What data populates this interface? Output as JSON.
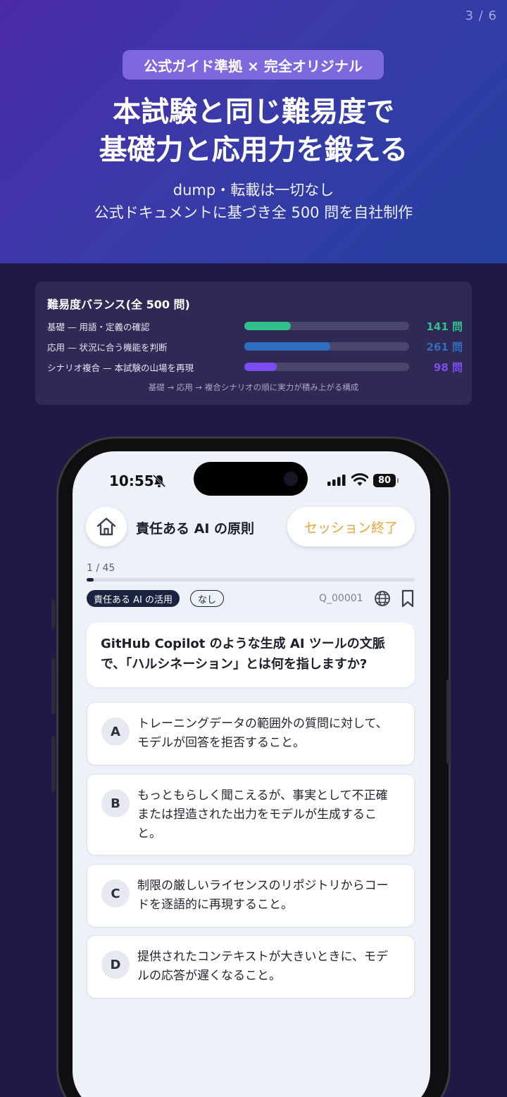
{
  "page_counter": "3 / 6",
  "hero": {
    "badge": "公式ガイド準拠 × 完全オリジナル",
    "headline_line1": "本試験と同じ難易度で",
    "headline_line2": "基礎力と応用力を鍛える",
    "sub_line1": "dump・転載は一切なし",
    "sub_line2": "公式ドキュメントに基づき全 500 問を自社制作"
  },
  "difficulty": {
    "title": "難易度バランス(全 500 問)",
    "rows": [
      {
        "label": "基礎 — 用語・定義の確認",
        "count": "141 問",
        "value": 141,
        "color": "#2fc08c"
      },
      {
        "label": "応用 — 状況に合う機能を判断",
        "count": "261 問",
        "value": 261,
        "color": "#2f6ec0"
      },
      {
        "label": "シナリオ複合 — 本試験の山場を再現",
        "count": "98 問",
        "value": 98,
        "color": "#7b4df0"
      }
    ],
    "total": 500,
    "footer": "基礎 → 応用 → 複合シナリオの順に実力が積み上がる構成"
  },
  "phone": {
    "status": {
      "time": "10:55",
      "battery": "80"
    },
    "header": {
      "title": "責任ある AI の原則",
      "end_button": "セッション終了"
    },
    "progress": {
      "label": "1 / 45",
      "fraction": 0.0222
    },
    "tags": {
      "category": "責任ある AI の活用",
      "level": "なし"
    },
    "question_id": "Q_00001",
    "question": "GitHub Copilot のような生成 AI ツールの文脈で、「ハルシネーション」とは何を指しますか?",
    "options": [
      {
        "letter": "A",
        "text": "トレーニングデータの範囲外の質問に対して、モデルが回答を拒否すること。"
      },
      {
        "letter": "B",
        "text": "もっともらしく聞こえるが、事実として不正確または捏造された出力をモデルが生成すること。"
      },
      {
        "letter": "C",
        "text": "制限の厳しいライセンスのリポジトリからコードを逐語的に再現すること。"
      },
      {
        "letter": "D",
        "text": "提供されたコンテキストが大きいときに、モデルの応答が遅くなること。"
      }
    ]
  }
}
